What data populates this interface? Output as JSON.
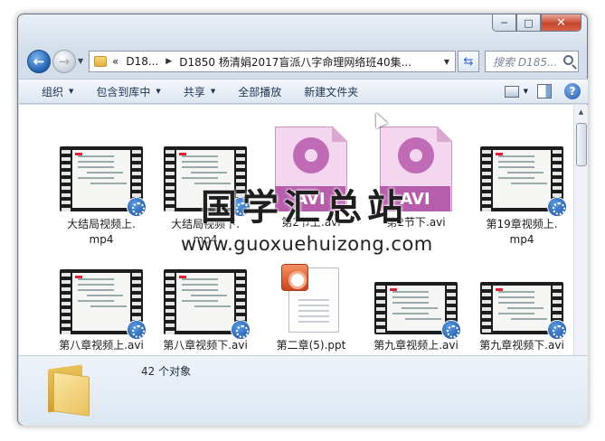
{
  "window": {
    "controls": {
      "minimize": "─",
      "maximize": "□",
      "close": "✕"
    }
  },
  "nav": {
    "history_label": "▼",
    "breadcrumb_overflow": "«",
    "breadcrumb_1": "D18...",
    "breadcrumb_2": "D1850 杨清娟2017盲派八字命理网络班40集...",
    "search_placeholder": "搜索 D185..."
  },
  "toolbar": {
    "organize": "组织",
    "include_in_library": "包含到库中",
    "share": "共享",
    "play_all": "全部播放",
    "new_folder": "新建文件夹"
  },
  "files": [
    {
      "name": "大结局视频上.\nmp4",
      "type": "mp4"
    },
    {
      "name": "大结局视频下.\nmp4",
      "type": "mp4"
    },
    {
      "name": "第2节上.avi",
      "type": "avi",
      "icon_text": "AVI"
    },
    {
      "name": "第2节下.avi",
      "type": "avi",
      "icon_text": "AVI"
    },
    {
      "name": "第19章视频上.\nmp4",
      "type": "mp4"
    },
    {
      "name": "第八章视频上.avi",
      "type": "avi-video"
    },
    {
      "name": "第八章视频下.avi",
      "type": "avi-video"
    },
    {
      "name": "第二章(5).ppt",
      "type": "ppt"
    },
    {
      "name": "第九章视频上.avi",
      "type": "avi-video"
    },
    {
      "name": "第九章视频下.avi",
      "type": "avi-video"
    }
  ],
  "watermark": {
    "title": "国学汇总站",
    "url": "www.guoxuehuizong.com"
  },
  "details": {
    "item_count": "42 个对象"
  },
  "colors": {
    "accent": "#1f5fb0",
    "avi_band": "#b65eab",
    "toolbar_text": "#1e3556"
  }
}
